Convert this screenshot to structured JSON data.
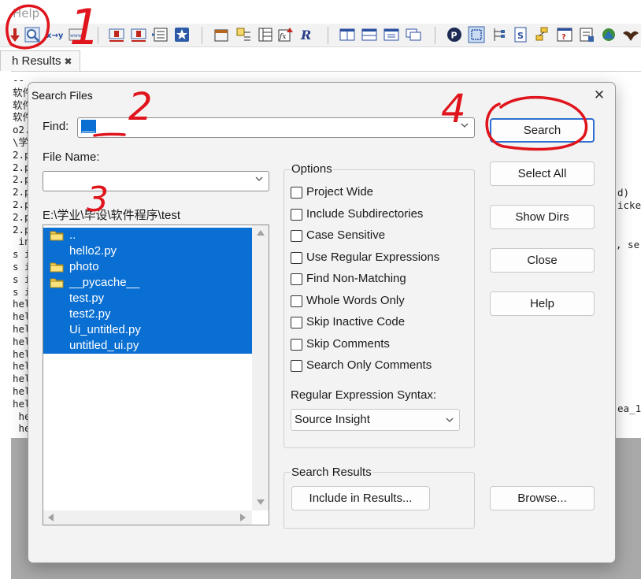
{
  "background_app": {
    "menu_help": "Help",
    "results_tab": {
      "label": "h Results",
      "close_glyph": "✖"
    },
    "editor_lines": [
      "--",
      "软件",
      "软件",
      "软件",
      "o2.",
      "\\学",
      "2.p",
      "2.p",
      "2.p",
      "2.p",
      "2.p",
      "2.p",
      "2.p",
      " in",
      "s i",
      "s i",
      "s i",
      "s i",
      "hel",
      "hel",
      "hel",
      "hel",
      "hel",
      "hel",
      "hel",
      "hel",
      "hel",
      " he",
      " he"
    ],
    "editor_right_fragments": [
      "d)",
      "icke",
      ", se",
      "ea_1"
    ],
    "toolbar_icons": [
      "sort-down-icon",
      "search-files-icon",
      "replace-icon",
      "web-icon",
      "bookmark-prev-icon",
      "bookmark-next-icon",
      "list-icon",
      "star-icon",
      "window-icon",
      "relation-icon",
      "function-list-icon",
      "fx-icon",
      "r-icon",
      "layout-1-icon",
      "layout-2-icon",
      "layout-3-icon",
      "layout-4-icon",
      "parking-icon",
      "select-icon",
      "tree-icon",
      "script-icon",
      "hierarchy-icon",
      "help-query-icon",
      "properties-icon",
      "refresh-icon",
      "eagle-icon"
    ]
  },
  "dialog": {
    "title": "Search Files",
    "close_glyph": "✕",
    "find": {
      "label": "Find:",
      "value": "__"
    },
    "file_name": {
      "label": "File Name:",
      "value": ""
    },
    "directory": "E:\\学业\\毕设\\软件程序\\test",
    "files": [
      {
        "name": "..",
        "folder": true
      },
      {
        "name": "hello2.py",
        "folder": false
      },
      {
        "name": "photo",
        "folder": true
      },
      {
        "name": "__pycache__",
        "folder": true
      },
      {
        "name": "test.py",
        "folder": false
      },
      {
        "name": "test2.py",
        "folder": false
      },
      {
        "name": "Ui_untitled.py",
        "folder": false
      },
      {
        "name": "untitled_ui.py",
        "folder": false
      }
    ],
    "options": {
      "title": "Options",
      "items": [
        {
          "label": "Project Wide",
          "checked": false
        },
        {
          "label": "Include Subdirectories",
          "checked": false
        },
        {
          "label": "Case Sensitive",
          "checked": false
        },
        {
          "label": "Use Regular Expressions",
          "checked": false
        },
        {
          "label": "Find Non-Matching",
          "checked": false
        },
        {
          "label": "Whole Words Only",
          "checked": false
        },
        {
          "label": "Skip Inactive Code",
          "checked": false
        },
        {
          "label": "Skip Comments",
          "checked": false
        },
        {
          "label": "Search Only Comments",
          "checked": false
        }
      ],
      "regex_syntax_label": "Regular Expression Syntax:",
      "regex_syntax_value": "Source Insight"
    },
    "search_results": {
      "title": "Search Results",
      "include_button": "Include in Results..."
    },
    "buttons": {
      "search": "Search",
      "select_all": "Select All",
      "show_dirs": "Show Dirs",
      "close": "Close",
      "help": "Help",
      "browse": "Browse..."
    },
    "selection_color": "#0a6fd2",
    "default_button_border": "#2f6fcf"
  },
  "annotations": {
    "color": "#e0141c",
    "labels": [
      "1",
      "2",
      "3",
      "4"
    ]
  }
}
